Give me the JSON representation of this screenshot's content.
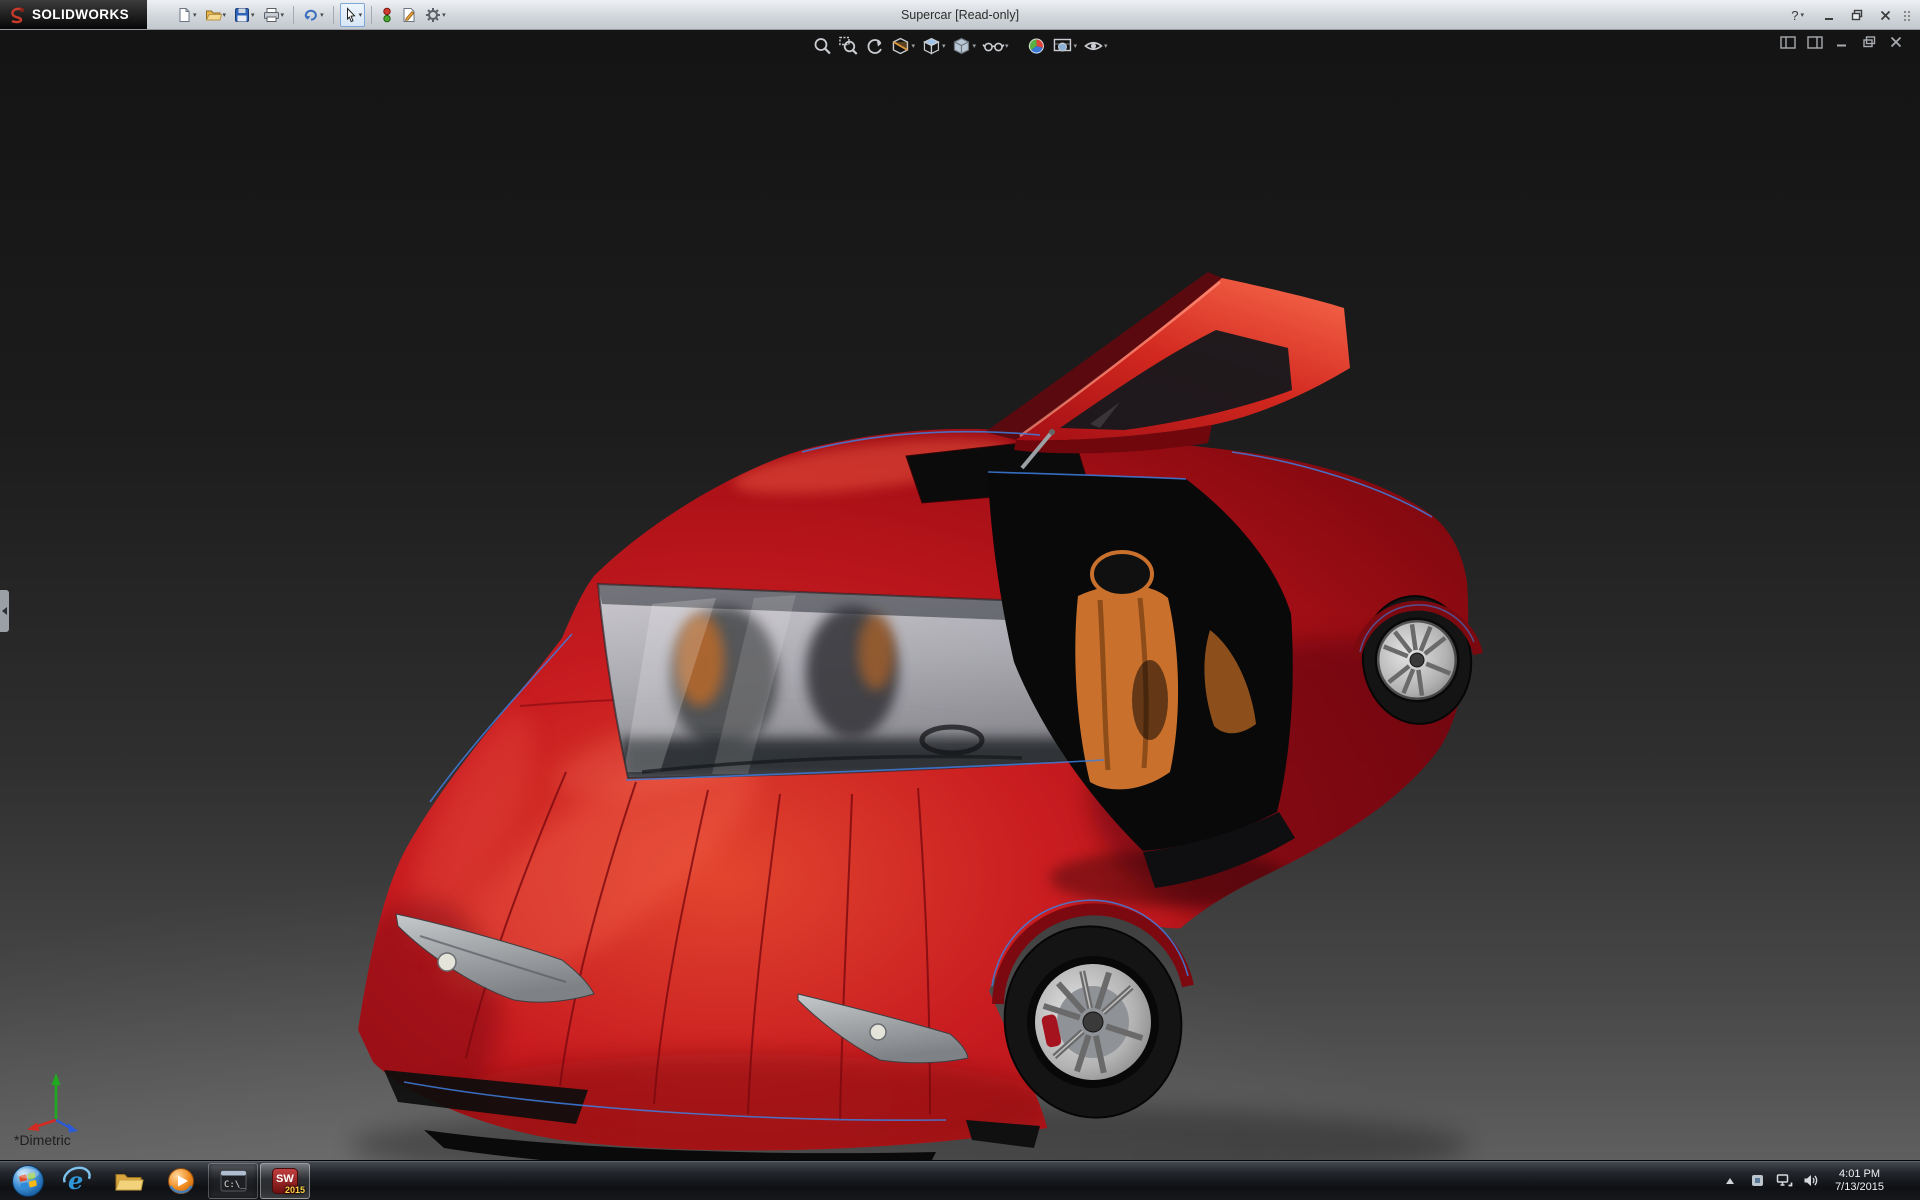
{
  "titlebar": {
    "app_name": "SOLIDWORKS",
    "document_title": "Supercar [Read-only]",
    "help_label": "?",
    "toolbar_icons": [
      "new-document",
      "open",
      "save",
      "print",
      "undo",
      "select",
      "rebuild",
      "file-properties",
      "options"
    ],
    "window_controls": [
      "minimize",
      "restore",
      "close"
    ]
  },
  "headsup_toolbar": {
    "icons": [
      "zoom-to-fit",
      "zoom-to-area",
      "previous-view",
      "section-view",
      "view-orientation",
      "display-style",
      "hide-show-items",
      "edit-appearance",
      "apply-scene",
      "view-settings"
    ]
  },
  "viewport": {
    "orientation_label": "*Dimetric",
    "window_controls": [
      "split-pane-left",
      "split-pane-right",
      "minimize",
      "restore",
      "close"
    ],
    "scene": {
      "subject": "red supercar, right gullwing door open",
      "car_paint": "#c41420",
      "seat_orange": "#c9712c",
      "edge_highlight_blue": "#3f7ede"
    }
  },
  "taskbar": {
    "items": [
      "start",
      "internet-explorer",
      "file-explorer",
      "media-player",
      "command-prompt",
      "solidworks-2015"
    ],
    "solidworks_badge": "2015",
    "tray": {
      "time": "4:01 PM",
      "date": "7/13/2015",
      "icons": [
        "hidden-icons",
        "tray-app",
        "network",
        "volume"
      ]
    }
  },
  "colors": {
    "titlebar_bg": "#d3d8dd",
    "viewport_top": "#151515",
    "viewport_bottom": "#5e5e5e",
    "taskbar_bg": "#121417"
  }
}
